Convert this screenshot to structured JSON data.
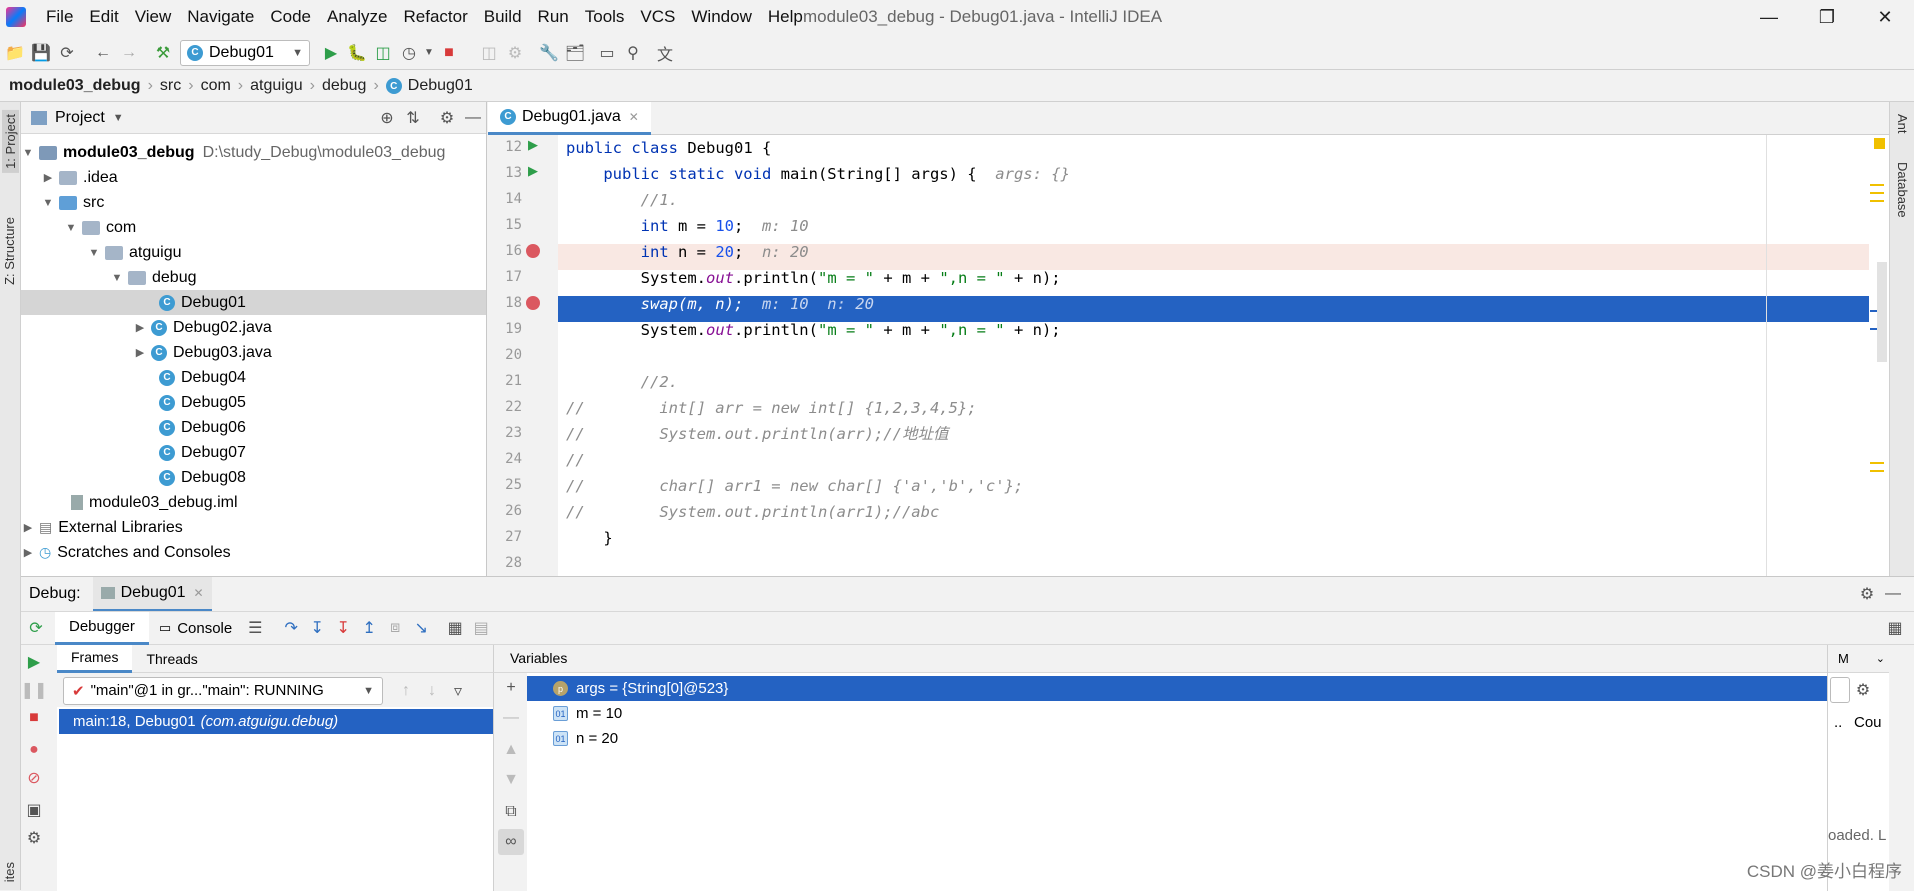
{
  "menu": [
    "File",
    "Edit",
    "View",
    "Navigate",
    "Code",
    "Analyze",
    "Refactor",
    "Build",
    "Run",
    "Tools",
    "VCS",
    "Window",
    "Help"
  ],
  "window_title": "module03_debug - Debug01.java - IntelliJ IDEA",
  "toolbar": {
    "run_config": "Debug01"
  },
  "breadcrumb": [
    "module03_debug",
    "src",
    "com",
    "atguigu",
    "debug",
    "Debug01"
  ],
  "side_tabs": {
    "project": "1: Project",
    "structure": "Z: Structure",
    "ant": "Ant",
    "database": "Database",
    "favorites": "ites"
  },
  "project": {
    "title": "Project",
    "root": "module03_debug",
    "root_path": "D:\\study_Debug\\module03_debug",
    "items": [
      ".idea",
      "src",
      "com",
      "atguigu",
      "debug",
      "Debug01",
      "Debug02.java",
      "Debug03.java",
      "Debug04",
      "Debug05",
      "Debug06",
      "Debug07",
      "Debug08",
      "module03_debug.iml",
      "External Libraries",
      "Scratches and Consoles"
    ]
  },
  "editor": {
    "tab": "Debug01.java",
    "line_numbers": [
      "12",
      "13",
      "14",
      "15",
      "16",
      "17",
      "18",
      "19",
      "20",
      "21",
      "22",
      "23",
      "24",
      "25",
      "26",
      "27",
      "28"
    ],
    "lines": {
      "l12": {
        "kw1": "public class ",
        "t1": "Debug01 {"
      },
      "l13": {
        "kw1": "    public static void ",
        "t1": "main(String[] args) {  ",
        "hint": "args: {}"
      },
      "l14": {
        "cm": "        //1."
      },
      "l15": {
        "kw1": "        int ",
        "t1": "m = ",
        "nm": "10",
        "t2": ";  ",
        "hint": "m: 10"
      },
      "l16": {
        "kw1": "        int ",
        "t1": "n = ",
        "nm": "20",
        "t2": ";  ",
        "hint": "n: 20"
      },
      "l17": {
        "t1": "        System.",
        "fld": "out",
        "t2": ".println(",
        "st1": "\"m = \"",
        "t3": " + m + ",
        "st2": "\",n = \"",
        "t4": " + n);"
      },
      "l18": {
        "t1": "        swap(m, n);  ",
        "hint": "m: 10  n: 20"
      },
      "l19": {
        "t1": "        System.",
        "fld": "out",
        "t2": ".println(",
        "st1": "\"m = \"",
        "t3": " + m + ",
        "st2": "\",n = \"",
        "t4": " + n);"
      },
      "l21": {
        "cm": "        //2."
      },
      "l22": {
        "cm": "//        int[] arr = new int[] {1,2,3,4,5};"
      },
      "l23": {
        "cm": "//        System.out.println(arr);//地址值"
      },
      "l24": {
        "cm": "//"
      },
      "l25": {
        "cm": "//        char[] arr1 = new char[] {'a','b','c'};"
      },
      "l26": {
        "cm": "//        System.out.println(arr1);//abc"
      },
      "l27": {
        "t1": "    }"
      }
    }
  },
  "debug": {
    "label": "Debug:",
    "session_tab": "Debug01",
    "tab_debugger": "Debugger",
    "tab_console": "Console",
    "frames_tab": "Frames",
    "threads_tab": "Threads",
    "thread_select": "\"main\"@1 in gr...\"main\": RUNNING",
    "frame_method": "main:18, Debug01",
    "frame_pkg": "(com.atguigu.debug)",
    "variables_title": "Variables",
    "variables": [
      {
        "badge": "p",
        "text": "args = {String[0]@523}"
      },
      {
        "badge": "01",
        "text": "m = 10"
      },
      {
        "badge": "01",
        "text": "n = 20"
      }
    ],
    "memory_col": "M",
    "count_col": "Cou",
    "loaded_text": "oaded. L"
  },
  "watermark": "CSDN @姜小白程序",
  "colors": {
    "selection": "#2462c2",
    "breakpoint_line": "#f9e8e3",
    "accent": "#3d9bd2",
    "run_green": "#2e9e4a",
    "stop_red": "#d83a3a"
  }
}
